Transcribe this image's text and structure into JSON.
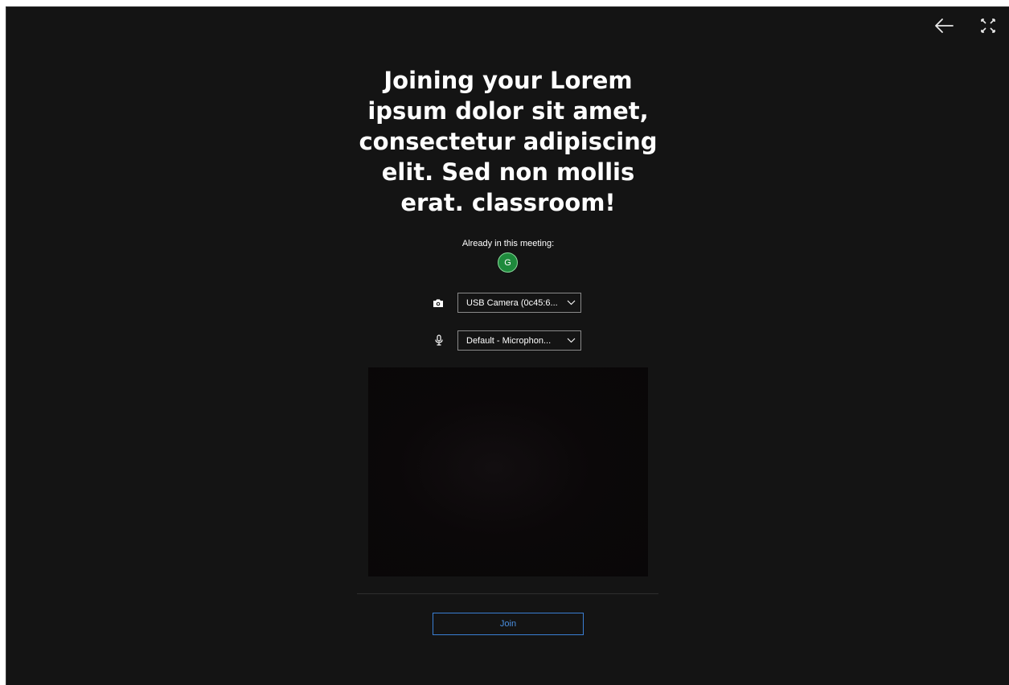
{
  "header": {
    "back_icon": "arrow-left-icon",
    "fullscreen_icon": "fullscreen-icon"
  },
  "main": {
    "title": "Joining your Lorem ipsum dolor sit amet, consectetur adipiscing elit. Sed non mollis erat. classroom!",
    "already_label": "Already in this meeting:",
    "participants": [
      {
        "initial": "G",
        "color": "#1e8a3c"
      }
    ],
    "camera": {
      "icon": "camera-icon",
      "selected": "USB Camera (0c45:6..."
    },
    "microphone": {
      "icon": "microphone-icon",
      "selected": "Default - Microphon..."
    },
    "join_label": "Join",
    "accent_color": "#4a90e2"
  }
}
